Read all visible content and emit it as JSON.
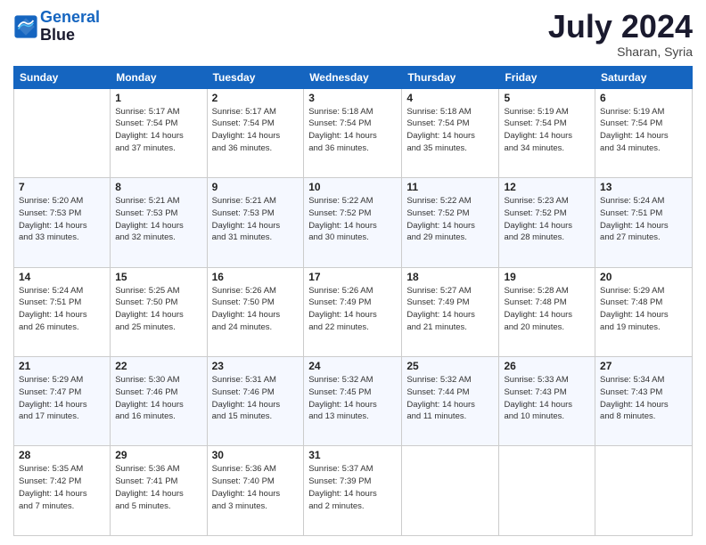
{
  "header": {
    "logo_line1": "General",
    "logo_line2": "Blue",
    "month": "July 2024",
    "location": "Sharan, Syria"
  },
  "columns": [
    "Sunday",
    "Monday",
    "Tuesday",
    "Wednesday",
    "Thursday",
    "Friday",
    "Saturday"
  ],
  "weeks": [
    [
      {
        "day": "",
        "info": ""
      },
      {
        "day": "1",
        "info": "Sunrise: 5:17 AM\nSunset: 7:54 PM\nDaylight: 14 hours\nand 37 minutes."
      },
      {
        "day": "2",
        "info": "Sunrise: 5:17 AM\nSunset: 7:54 PM\nDaylight: 14 hours\nand 36 minutes."
      },
      {
        "day": "3",
        "info": "Sunrise: 5:18 AM\nSunset: 7:54 PM\nDaylight: 14 hours\nand 36 minutes."
      },
      {
        "day": "4",
        "info": "Sunrise: 5:18 AM\nSunset: 7:54 PM\nDaylight: 14 hours\nand 35 minutes."
      },
      {
        "day": "5",
        "info": "Sunrise: 5:19 AM\nSunset: 7:54 PM\nDaylight: 14 hours\nand 34 minutes."
      },
      {
        "day": "6",
        "info": "Sunrise: 5:19 AM\nSunset: 7:54 PM\nDaylight: 14 hours\nand 34 minutes."
      }
    ],
    [
      {
        "day": "7",
        "info": "Sunrise: 5:20 AM\nSunset: 7:53 PM\nDaylight: 14 hours\nand 33 minutes."
      },
      {
        "day": "8",
        "info": "Sunrise: 5:21 AM\nSunset: 7:53 PM\nDaylight: 14 hours\nand 32 minutes."
      },
      {
        "day": "9",
        "info": "Sunrise: 5:21 AM\nSunset: 7:53 PM\nDaylight: 14 hours\nand 31 minutes."
      },
      {
        "day": "10",
        "info": "Sunrise: 5:22 AM\nSunset: 7:52 PM\nDaylight: 14 hours\nand 30 minutes."
      },
      {
        "day": "11",
        "info": "Sunrise: 5:22 AM\nSunset: 7:52 PM\nDaylight: 14 hours\nand 29 minutes."
      },
      {
        "day": "12",
        "info": "Sunrise: 5:23 AM\nSunset: 7:52 PM\nDaylight: 14 hours\nand 28 minutes."
      },
      {
        "day": "13",
        "info": "Sunrise: 5:24 AM\nSunset: 7:51 PM\nDaylight: 14 hours\nand 27 minutes."
      }
    ],
    [
      {
        "day": "14",
        "info": "Sunrise: 5:24 AM\nSunset: 7:51 PM\nDaylight: 14 hours\nand 26 minutes."
      },
      {
        "day": "15",
        "info": "Sunrise: 5:25 AM\nSunset: 7:50 PM\nDaylight: 14 hours\nand 25 minutes."
      },
      {
        "day": "16",
        "info": "Sunrise: 5:26 AM\nSunset: 7:50 PM\nDaylight: 14 hours\nand 24 minutes."
      },
      {
        "day": "17",
        "info": "Sunrise: 5:26 AM\nSunset: 7:49 PM\nDaylight: 14 hours\nand 22 minutes."
      },
      {
        "day": "18",
        "info": "Sunrise: 5:27 AM\nSunset: 7:49 PM\nDaylight: 14 hours\nand 21 minutes."
      },
      {
        "day": "19",
        "info": "Sunrise: 5:28 AM\nSunset: 7:48 PM\nDaylight: 14 hours\nand 20 minutes."
      },
      {
        "day": "20",
        "info": "Sunrise: 5:29 AM\nSunset: 7:48 PM\nDaylight: 14 hours\nand 19 minutes."
      }
    ],
    [
      {
        "day": "21",
        "info": "Sunrise: 5:29 AM\nSunset: 7:47 PM\nDaylight: 14 hours\nand 17 minutes."
      },
      {
        "day": "22",
        "info": "Sunrise: 5:30 AM\nSunset: 7:46 PM\nDaylight: 14 hours\nand 16 minutes."
      },
      {
        "day": "23",
        "info": "Sunrise: 5:31 AM\nSunset: 7:46 PM\nDaylight: 14 hours\nand 15 minutes."
      },
      {
        "day": "24",
        "info": "Sunrise: 5:32 AM\nSunset: 7:45 PM\nDaylight: 14 hours\nand 13 minutes."
      },
      {
        "day": "25",
        "info": "Sunrise: 5:32 AM\nSunset: 7:44 PM\nDaylight: 14 hours\nand 11 minutes."
      },
      {
        "day": "26",
        "info": "Sunrise: 5:33 AM\nSunset: 7:43 PM\nDaylight: 14 hours\nand 10 minutes."
      },
      {
        "day": "27",
        "info": "Sunrise: 5:34 AM\nSunset: 7:43 PM\nDaylight: 14 hours\nand 8 minutes."
      }
    ],
    [
      {
        "day": "28",
        "info": "Sunrise: 5:35 AM\nSunset: 7:42 PM\nDaylight: 14 hours\nand 7 minutes."
      },
      {
        "day": "29",
        "info": "Sunrise: 5:36 AM\nSunset: 7:41 PM\nDaylight: 14 hours\nand 5 minutes."
      },
      {
        "day": "30",
        "info": "Sunrise: 5:36 AM\nSunset: 7:40 PM\nDaylight: 14 hours\nand 3 minutes."
      },
      {
        "day": "31",
        "info": "Sunrise: 5:37 AM\nSunset: 7:39 PM\nDaylight: 14 hours\nand 2 minutes."
      },
      {
        "day": "",
        "info": ""
      },
      {
        "day": "",
        "info": ""
      },
      {
        "day": "",
        "info": ""
      }
    ]
  ]
}
